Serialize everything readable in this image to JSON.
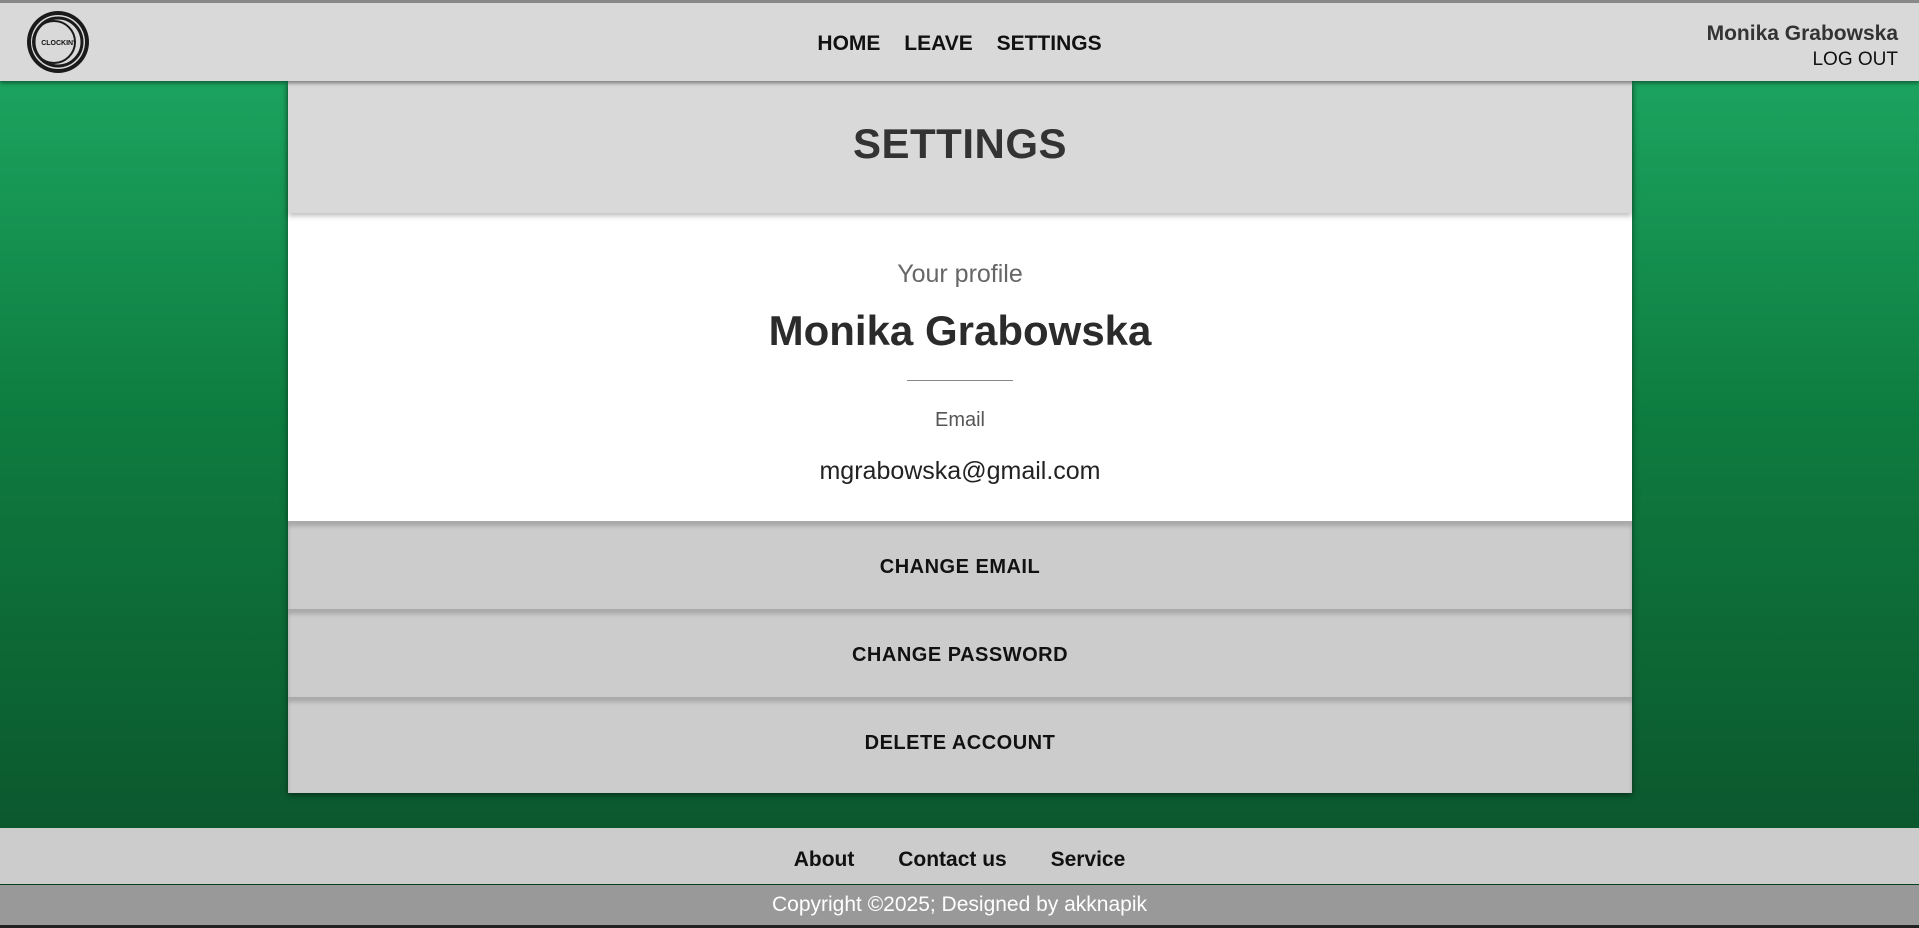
{
  "header": {
    "logo_text": "CLOCKIN'",
    "nav": [
      "HOME",
      "LEAVE",
      "SETTINGS"
    ],
    "user_name": "Monika Grabowska",
    "logout_label": "LOG OUT"
  },
  "settings": {
    "title": "SETTINGS",
    "profile_label": "Your profile",
    "full_name": "Monika Grabowska",
    "email_label": "Email",
    "email_value": "mgrabowska@gmail.com",
    "actions": [
      "CHANGE EMAIL",
      "CHANGE PASSWORD",
      "DELETE ACCOUNT"
    ]
  },
  "footer": {
    "links": [
      "About",
      "Contact us",
      "Service"
    ],
    "copyright": "Copyright ©2025; Designed by akknapik"
  }
}
